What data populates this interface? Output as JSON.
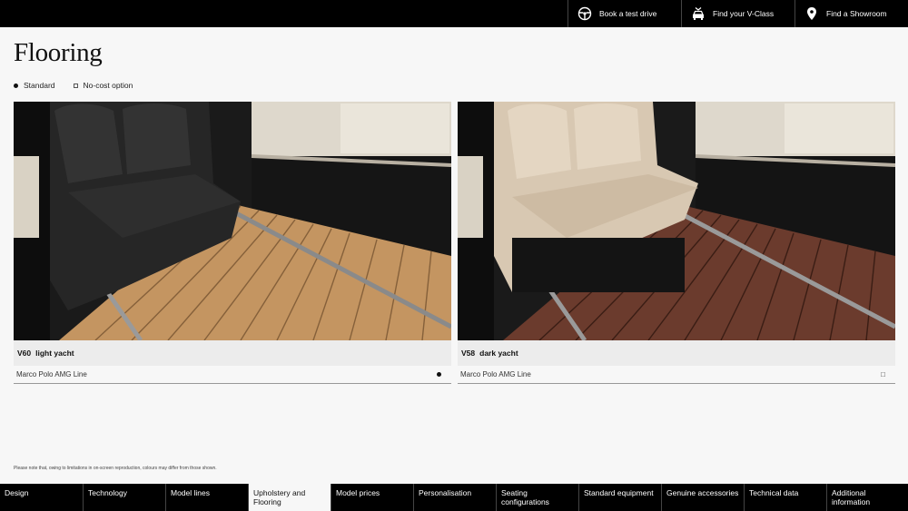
{
  "header": {
    "buttons": [
      {
        "label": "Book a test drive",
        "icon": "steering-wheel-icon"
      },
      {
        "label": "Find your V-Class",
        "icon": "car-search-icon"
      },
      {
        "label": "Find a Showroom",
        "icon": "location-pin-icon"
      }
    ]
  },
  "page": {
    "title": "Flooring"
  },
  "legend": {
    "standard": "Standard",
    "no_cost": "No-cost option"
  },
  "cards": [
    {
      "code": "V60",
      "name": "light yacht",
      "line": "Marco Polo AMG Line",
      "availability": "standard",
      "floor_color": "#b98b5c"
    },
    {
      "code": "V58",
      "name": "dark yacht",
      "line": "Marco Polo AMG Line",
      "availability": "no-cost",
      "mark": "□",
      "floor_color": "#6a3a2c"
    }
  ],
  "footnote": "Please note that, owing to limitations in on-screen reproduction, colours may differ from those shown.",
  "nav": [
    {
      "label": "Design"
    },
    {
      "label": "Technology"
    },
    {
      "label": "Model lines"
    },
    {
      "label": "Upholstery and Flooring",
      "active": true
    },
    {
      "label": "Model prices"
    },
    {
      "label": "Personalisation"
    },
    {
      "label": "Seating configurations"
    },
    {
      "label": "Standard equipment"
    },
    {
      "label": "Genuine accessories"
    },
    {
      "label": "Technical data"
    },
    {
      "label": "Additional information"
    }
  ]
}
